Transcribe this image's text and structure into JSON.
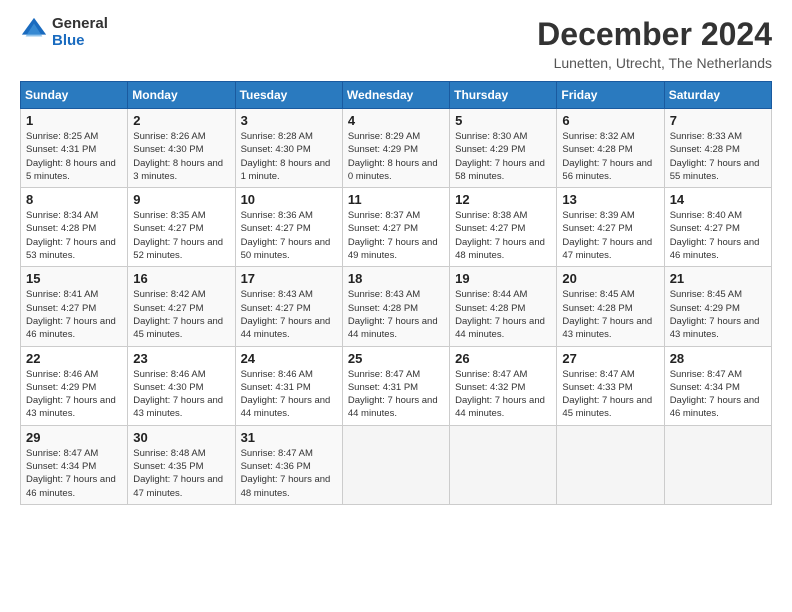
{
  "logo": {
    "text_general": "General",
    "text_blue": "Blue"
  },
  "title": "December 2024",
  "subtitle": "Lunetten, Utrecht, The Netherlands",
  "days_of_week": [
    "Sunday",
    "Monday",
    "Tuesday",
    "Wednesday",
    "Thursday",
    "Friday",
    "Saturday"
  ],
  "weeks": [
    [
      {
        "day": "1",
        "sunrise": "8:25 AM",
        "sunset": "4:31 PM",
        "daylight": "8 hours and 5 minutes."
      },
      {
        "day": "2",
        "sunrise": "8:26 AM",
        "sunset": "4:30 PM",
        "daylight": "8 hours and 3 minutes."
      },
      {
        "day": "3",
        "sunrise": "8:28 AM",
        "sunset": "4:30 PM",
        "daylight": "8 hours and 1 minute."
      },
      {
        "day": "4",
        "sunrise": "8:29 AM",
        "sunset": "4:29 PM",
        "daylight": "8 hours and 0 minutes."
      },
      {
        "day": "5",
        "sunrise": "8:30 AM",
        "sunset": "4:29 PM",
        "daylight": "7 hours and 58 minutes."
      },
      {
        "day": "6",
        "sunrise": "8:32 AM",
        "sunset": "4:28 PM",
        "daylight": "7 hours and 56 minutes."
      },
      {
        "day": "7",
        "sunrise": "8:33 AM",
        "sunset": "4:28 PM",
        "daylight": "7 hours and 55 minutes."
      }
    ],
    [
      {
        "day": "8",
        "sunrise": "8:34 AM",
        "sunset": "4:28 PM",
        "daylight": "7 hours and 53 minutes."
      },
      {
        "day": "9",
        "sunrise": "8:35 AM",
        "sunset": "4:27 PM",
        "daylight": "7 hours and 52 minutes."
      },
      {
        "day": "10",
        "sunrise": "8:36 AM",
        "sunset": "4:27 PM",
        "daylight": "7 hours and 50 minutes."
      },
      {
        "day": "11",
        "sunrise": "8:37 AM",
        "sunset": "4:27 PM",
        "daylight": "7 hours and 49 minutes."
      },
      {
        "day": "12",
        "sunrise": "8:38 AM",
        "sunset": "4:27 PM",
        "daylight": "7 hours and 48 minutes."
      },
      {
        "day": "13",
        "sunrise": "8:39 AM",
        "sunset": "4:27 PM",
        "daylight": "7 hours and 47 minutes."
      },
      {
        "day": "14",
        "sunrise": "8:40 AM",
        "sunset": "4:27 PM",
        "daylight": "7 hours and 46 minutes."
      }
    ],
    [
      {
        "day": "15",
        "sunrise": "8:41 AM",
        "sunset": "4:27 PM",
        "daylight": "7 hours and 46 minutes."
      },
      {
        "day": "16",
        "sunrise": "8:42 AM",
        "sunset": "4:27 PM",
        "daylight": "7 hours and 45 minutes."
      },
      {
        "day": "17",
        "sunrise": "8:43 AM",
        "sunset": "4:27 PM",
        "daylight": "7 hours and 44 minutes."
      },
      {
        "day": "18",
        "sunrise": "8:43 AM",
        "sunset": "4:28 PM",
        "daylight": "7 hours and 44 minutes."
      },
      {
        "day": "19",
        "sunrise": "8:44 AM",
        "sunset": "4:28 PM",
        "daylight": "7 hours and 44 minutes."
      },
      {
        "day": "20",
        "sunrise": "8:45 AM",
        "sunset": "4:28 PM",
        "daylight": "7 hours and 43 minutes."
      },
      {
        "day": "21",
        "sunrise": "8:45 AM",
        "sunset": "4:29 PM",
        "daylight": "7 hours and 43 minutes."
      }
    ],
    [
      {
        "day": "22",
        "sunrise": "8:46 AM",
        "sunset": "4:29 PM",
        "daylight": "7 hours and 43 minutes."
      },
      {
        "day": "23",
        "sunrise": "8:46 AM",
        "sunset": "4:30 PM",
        "daylight": "7 hours and 43 minutes."
      },
      {
        "day": "24",
        "sunrise": "8:46 AM",
        "sunset": "4:31 PM",
        "daylight": "7 hours and 44 minutes."
      },
      {
        "day": "25",
        "sunrise": "8:47 AM",
        "sunset": "4:31 PM",
        "daylight": "7 hours and 44 minutes."
      },
      {
        "day": "26",
        "sunrise": "8:47 AM",
        "sunset": "4:32 PM",
        "daylight": "7 hours and 44 minutes."
      },
      {
        "day": "27",
        "sunrise": "8:47 AM",
        "sunset": "4:33 PM",
        "daylight": "7 hours and 45 minutes."
      },
      {
        "day": "28",
        "sunrise": "8:47 AM",
        "sunset": "4:34 PM",
        "daylight": "7 hours and 46 minutes."
      }
    ],
    [
      {
        "day": "29",
        "sunrise": "8:47 AM",
        "sunset": "4:34 PM",
        "daylight": "7 hours and 46 minutes."
      },
      {
        "day": "30",
        "sunrise": "8:48 AM",
        "sunset": "4:35 PM",
        "daylight": "7 hours and 47 minutes."
      },
      {
        "day": "31",
        "sunrise": "8:47 AM",
        "sunset": "4:36 PM",
        "daylight": "7 hours and 48 minutes."
      },
      null,
      null,
      null,
      null
    ]
  ]
}
